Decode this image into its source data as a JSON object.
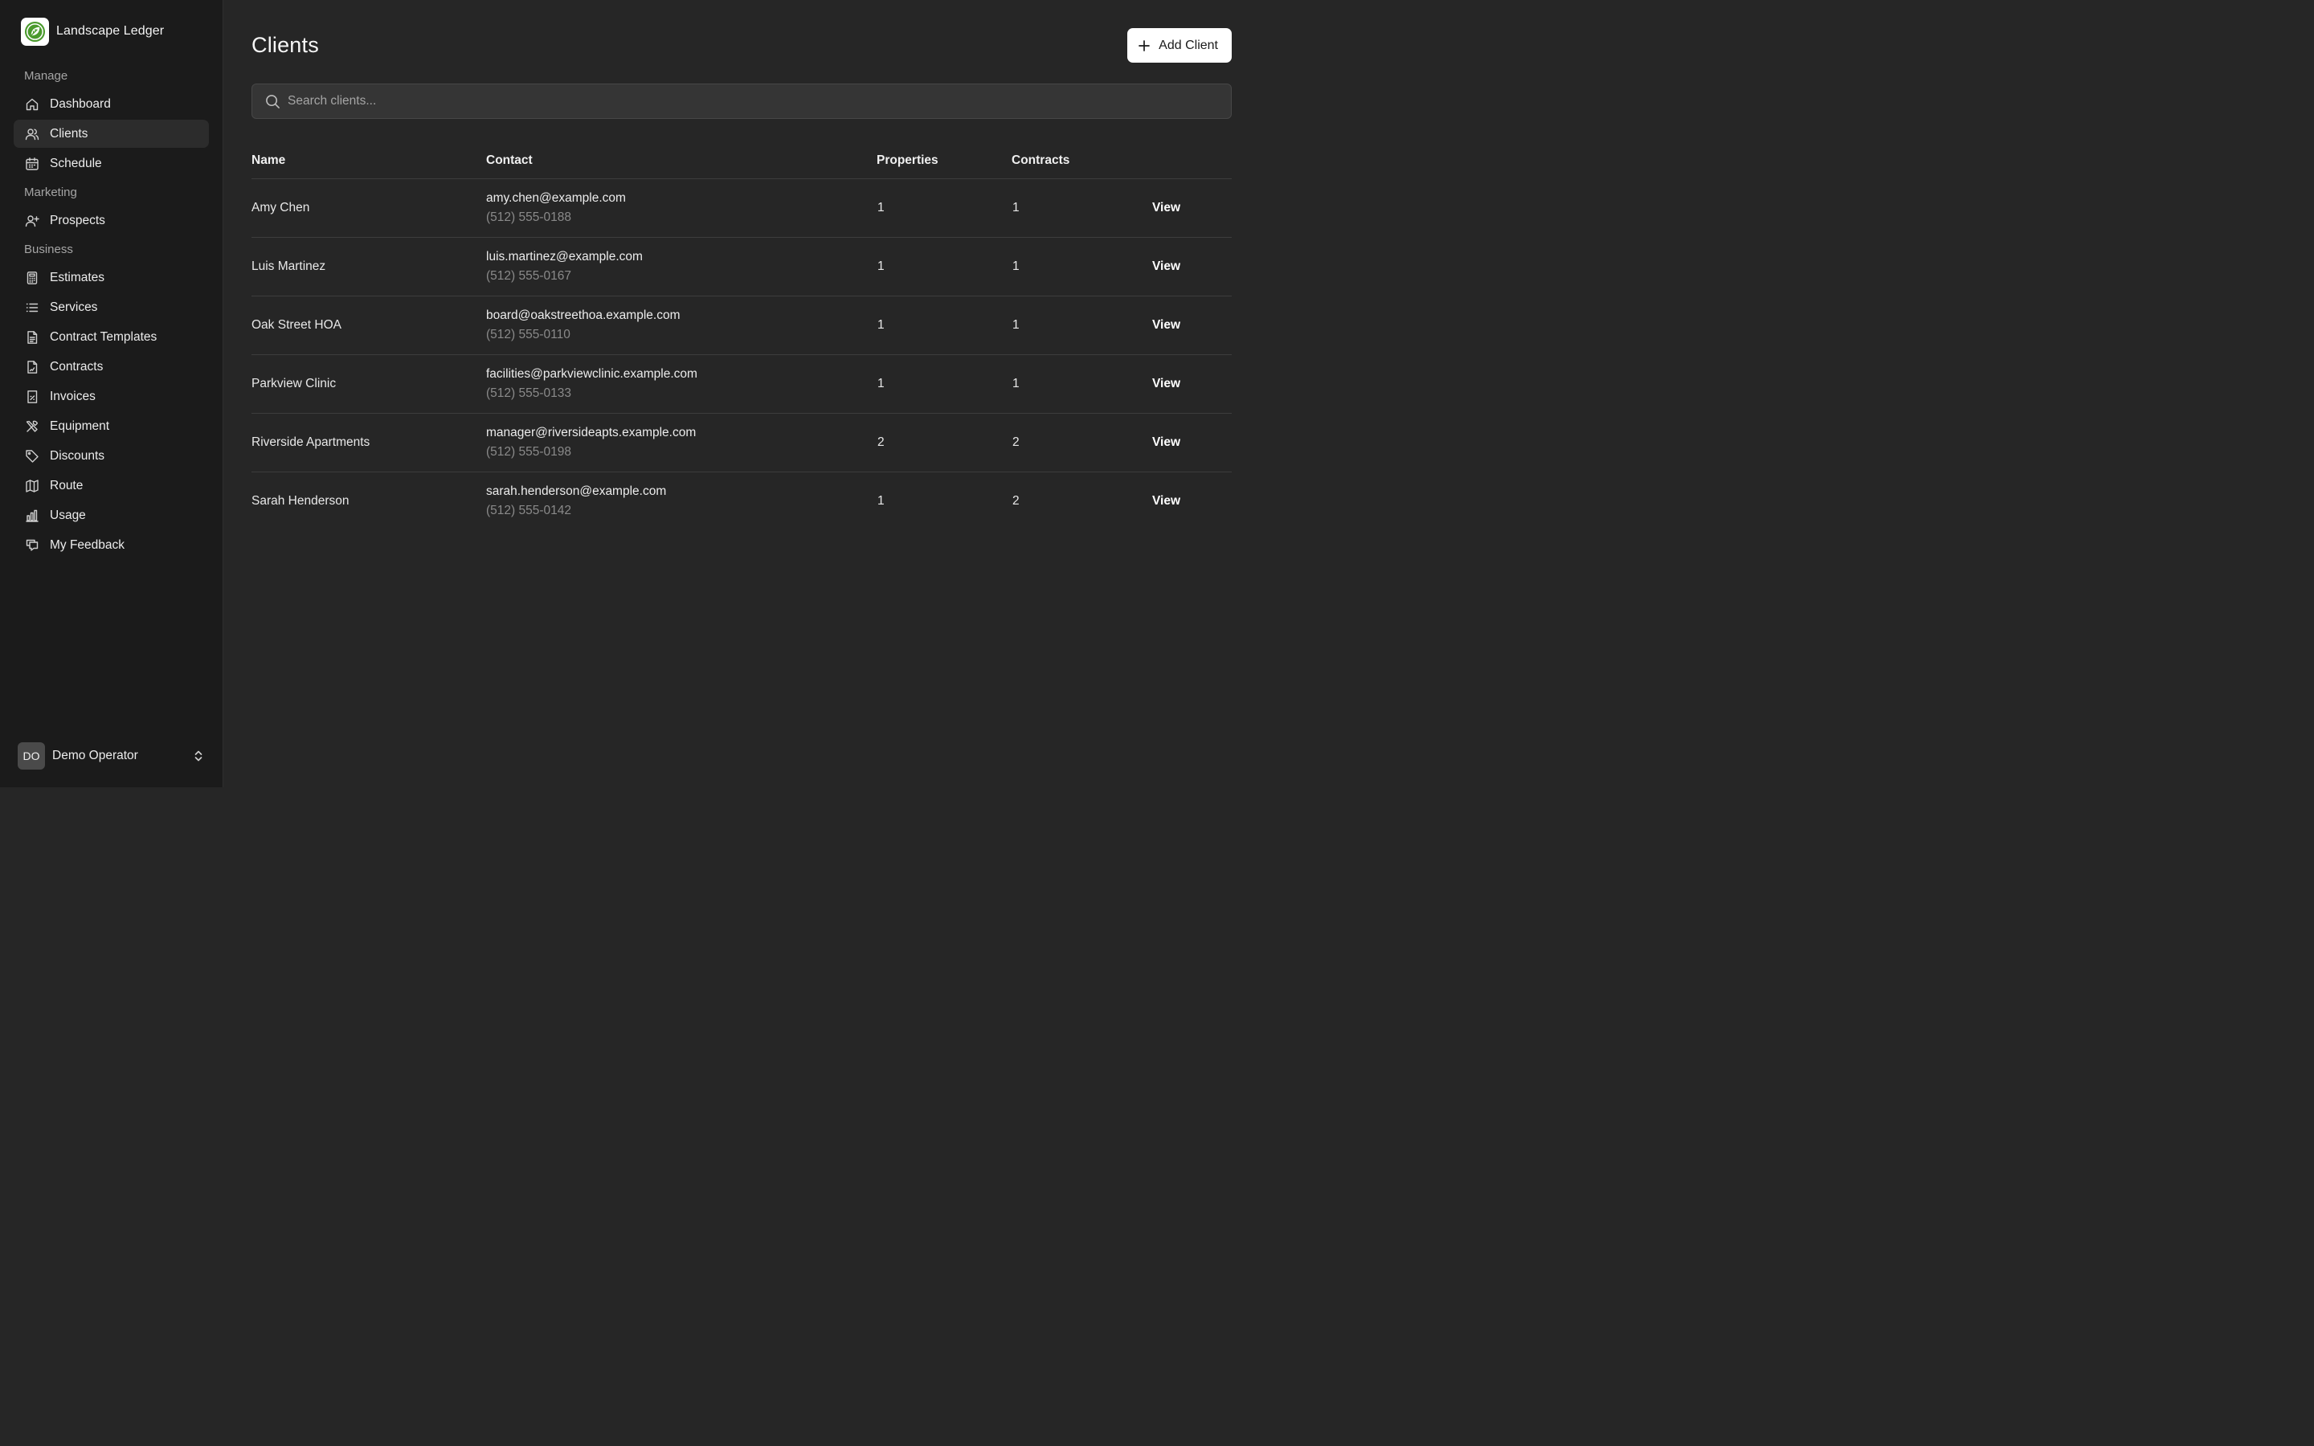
{
  "app": {
    "name": "Landscape Ledger"
  },
  "sidebar": {
    "sections": [
      {
        "label": "Manage",
        "items": [
          {
            "label": "Dashboard",
            "icon": "home-icon"
          },
          {
            "label": "Clients",
            "icon": "users-icon",
            "active": true
          },
          {
            "label": "Schedule",
            "icon": "calendar-icon"
          }
        ]
      },
      {
        "label": "Marketing",
        "items": [
          {
            "label": "Prospects",
            "icon": "user-plus-icon"
          }
        ]
      },
      {
        "label": "Business",
        "items": [
          {
            "label": "Estimates",
            "icon": "calculator-icon"
          },
          {
            "label": "Services",
            "icon": "list-icon"
          },
          {
            "label": "Contract Templates",
            "icon": "file-text-icon"
          },
          {
            "label": "Contracts",
            "icon": "file-signature-icon"
          },
          {
            "label": "Invoices",
            "icon": "receipt-icon"
          },
          {
            "label": "Equipment",
            "icon": "tools-icon"
          },
          {
            "label": "Discounts",
            "icon": "tag-icon"
          },
          {
            "label": "Route",
            "icon": "map-icon"
          },
          {
            "label": "Usage",
            "icon": "bar-chart-icon"
          },
          {
            "label": "My Feedback",
            "icon": "message-icon"
          }
        ]
      }
    ],
    "user": {
      "initials": "DO",
      "name": "Demo Operator"
    }
  },
  "main": {
    "title": "Clients",
    "add_button_label": "Add Client",
    "search_placeholder": "Search clients...",
    "columns": [
      "Name",
      "Contact",
      "Properties",
      "Contracts",
      ""
    ],
    "view_label": "View",
    "rows": [
      {
        "name": "Amy Chen",
        "email": "amy.chen@example.com",
        "phone": "(512) 555-0188",
        "properties": "1",
        "contracts": "1"
      },
      {
        "name": "Luis Martinez",
        "email": "luis.martinez@example.com",
        "phone": "(512) 555-0167",
        "properties": "1",
        "contracts": "1"
      },
      {
        "name": "Oak Street HOA",
        "email": "board@oakstreethoa.example.com",
        "phone": "(512) 555-0110",
        "properties": "1",
        "contracts": "1"
      },
      {
        "name": "Parkview Clinic",
        "email": "facilities@parkviewclinic.example.com",
        "phone": "(512) 555-0133",
        "properties": "1",
        "contracts": "1"
      },
      {
        "name": "Riverside Apartments",
        "email": "manager@riversideapts.example.com",
        "phone": "(512) 555-0198",
        "properties": "2",
        "contracts": "2"
      },
      {
        "name": "Sarah Henderson",
        "email": "sarah.henderson@example.com",
        "phone": "(512) 555-0142",
        "properties": "1",
        "contracts": "2"
      }
    ]
  },
  "colors": {
    "sidebar_bg": "#1b1b1b",
    "main_bg": "#262626",
    "logo_green": "#3f8f2a"
  }
}
